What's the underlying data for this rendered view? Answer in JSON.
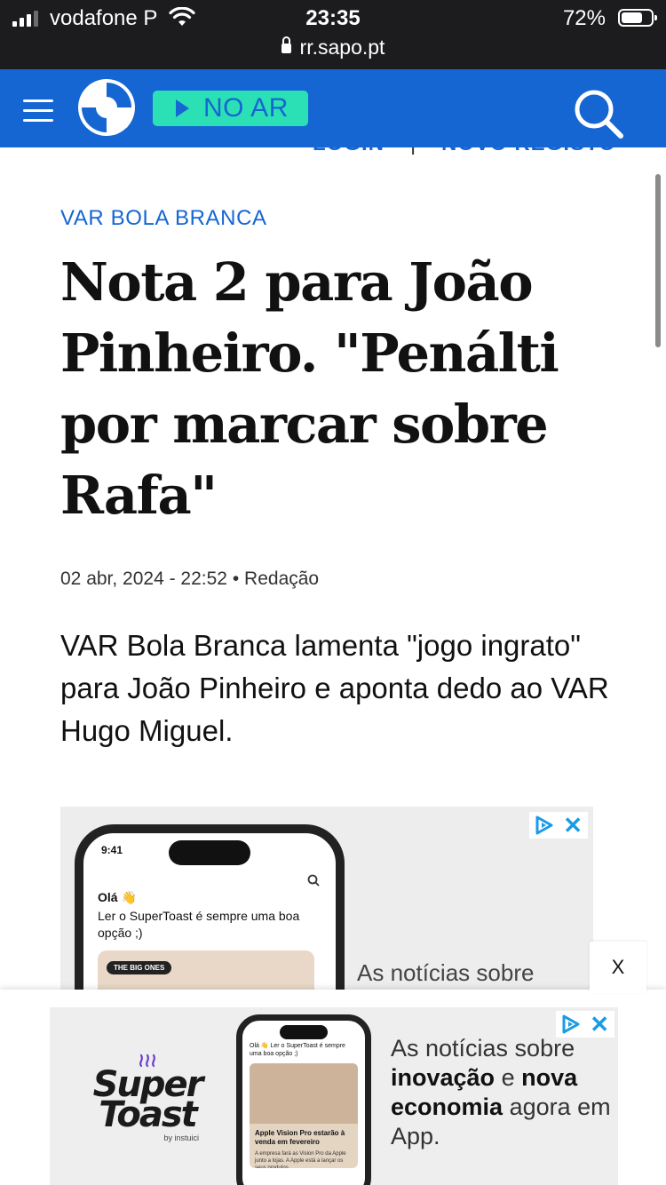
{
  "status_bar": {
    "carrier": "vodafone P",
    "time": "23:35",
    "url": "rr.sapo.pt",
    "battery_percent": "72%",
    "battery_level": 0.72,
    "signal_bars_active": 3,
    "signal_bars_total": 4
  },
  "navbar": {
    "live_label": "NO AR",
    "menu_icon": "hamburger-menu-icon",
    "logo_icon": "rr-logo",
    "search_icon": "search-icon",
    "background": "#1566d3",
    "live_color": "#2ce0b6"
  },
  "auth": {
    "login": "LOGIN",
    "separator": "|",
    "register": "NOVO REGISTO"
  },
  "article": {
    "category": "VAR BOLA BRANCA",
    "title": "Nota 2 para João Pinheiro. \"Penálti por marcar sobre Rafa\"",
    "date": "02 abr, 2024 - 22:52",
    "separator": "•",
    "author": "Redação",
    "lead": "VAR Bola Branca lamenta \"jogo ingrato\" para João Pinheiro e aponta dedo ao VAR Hugo Miguel."
  },
  "ad_top": {
    "phone_time": "9:41",
    "greeting": "Olá 👋",
    "message": "Ler o SuperToast é sempre uma boa opção ;)",
    "tag": "THE BIG ONES",
    "text": "As notícias sobre"
  },
  "sticky_ad": {
    "close": "X",
    "brand_name": "Super Toast",
    "brand_sub": "by instuici",
    "phone_text": "Olá 👋 Ler o SuperToast é sempre uma boa opção ;)",
    "card_title": "Apple Vision Pro estarão à venda em fevereiro",
    "card_body": "A empresa fará as Vision Pro da Apple junto a lojas. A Apple está a lançar os seus produtos",
    "text_1": "As notícias sobre",
    "text_2": "inovação",
    "text_3": "e",
    "text_4": "nova economia",
    "text_5": "agora em App."
  }
}
